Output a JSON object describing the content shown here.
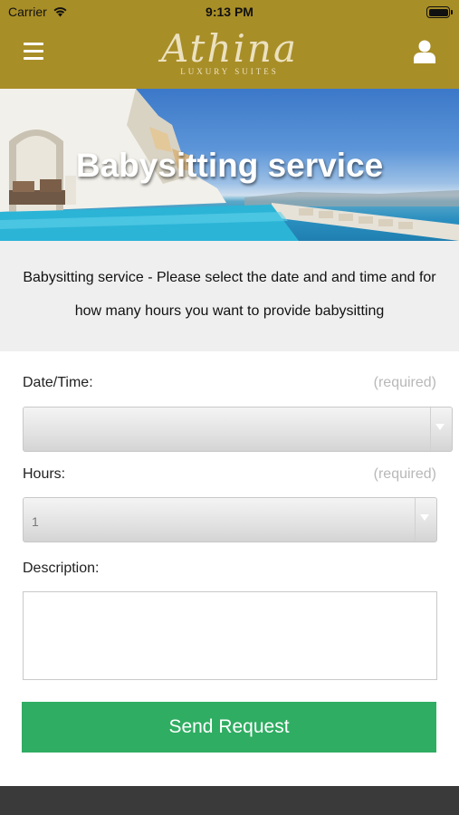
{
  "status_bar": {
    "carrier": "Carrier",
    "time": "9:13 PM",
    "icons": [
      "wifi-icon",
      "battery-icon"
    ]
  },
  "header": {
    "logo_script": "Athina",
    "logo_sub": "LUXURY SUITES",
    "menu_icon": "hamburger-menu-icon",
    "user_icon": "user-profile-icon",
    "background": "#a88e27"
  },
  "hero": {
    "title": "Babysitting service"
  },
  "intro": {
    "text": "Babysitting service - Please select the date and and time and for how many hours you want to provide babysitting"
  },
  "form": {
    "datetime": {
      "label": "Date/Time:",
      "required": "(required)",
      "value": ""
    },
    "hours": {
      "label": "Hours:",
      "required": "(required)",
      "value": "1"
    },
    "description": {
      "label": "Description:",
      "value": ""
    },
    "submit_label": "Send Request",
    "submit_color": "#2fad62"
  },
  "footer": {
    "background": "#3a3a3a"
  }
}
